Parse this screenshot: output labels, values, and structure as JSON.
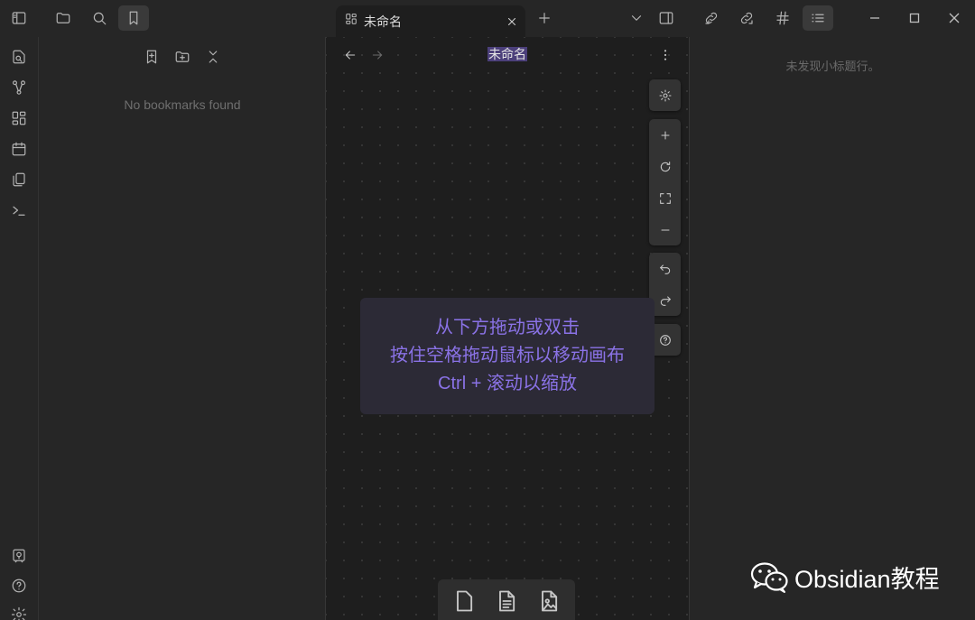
{
  "tab": {
    "title": "未命名"
  },
  "view": {
    "title": "未命名"
  },
  "left_sidebar": {
    "empty_message": "No bookmarks found"
  },
  "right_sidebar": {
    "empty_message": "未发现小标题行。"
  },
  "canvas_hint": {
    "line1": "从下方拖动或双击",
    "line2": "按住空格拖动鼠标以移动画布",
    "line3": "Ctrl + 滚动以缩放"
  },
  "watermark": {
    "text": "Obsidian教程"
  },
  "colors": {
    "accent": "#8a72e6",
    "title_highlight": "#4b3f7a",
    "canvas_bg": "#1e1e1e",
    "chrome_bg": "#262626"
  },
  "icons": {
    "titlebar": [
      "sidebar-toggle-icon",
      "folder-icon",
      "search-icon",
      "bookmark-icon",
      "plus-icon",
      "chevron-down-icon",
      "right-sidebar-toggle-icon",
      "backlink-icon",
      "outgoing-link-icon",
      "hashtag-icon",
      "outline-list-icon"
    ],
    "ribbon": [
      "quick-switcher-icon",
      "graph-icon",
      "canvas-icon",
      "calendar-icon",
      "templates-icon",
      "terminal-icon",
      "vault-icon",
      "help-icon",
      "settings-icon"
    ]
  }
}
